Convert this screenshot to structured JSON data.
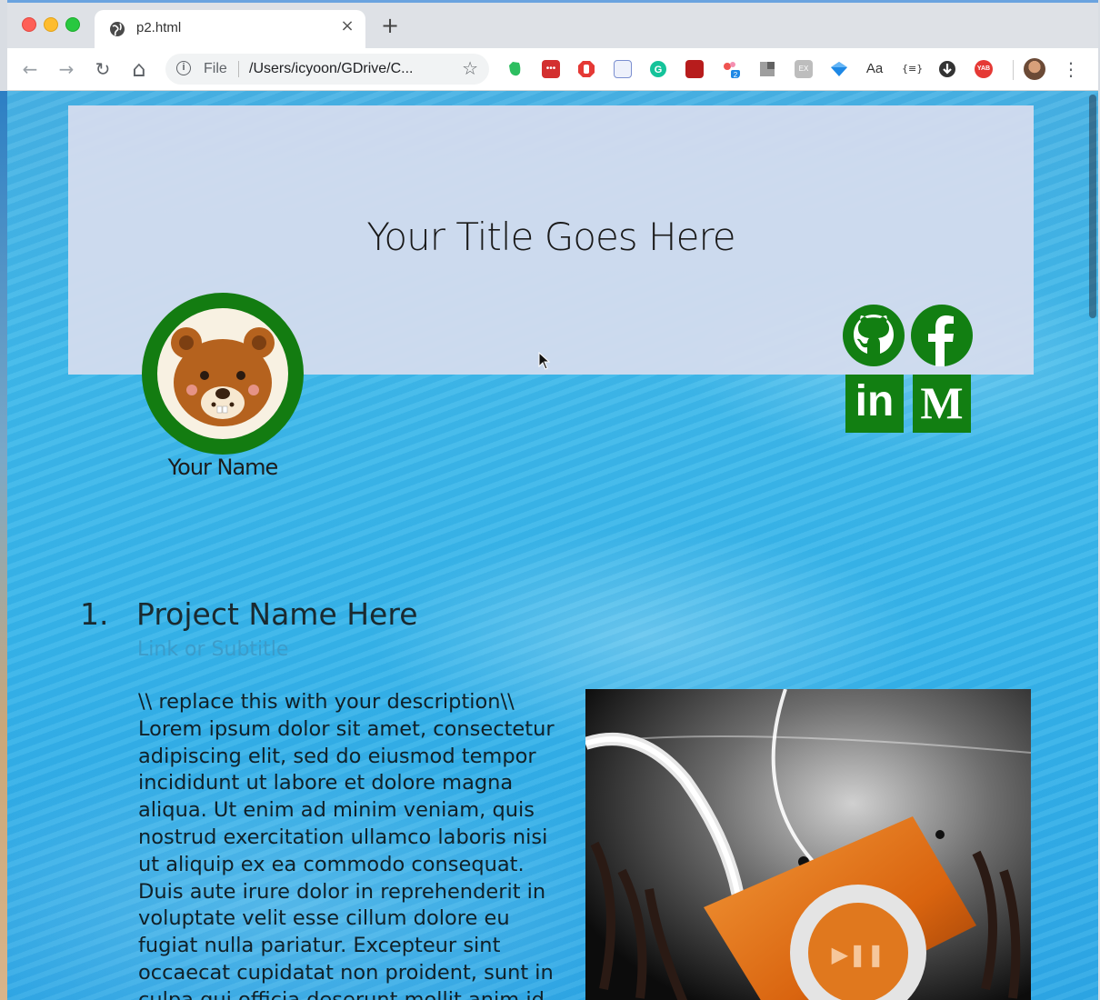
{
  "browser": {
    "tab_title": "p2.html",
    "tab_close": "×",
    "new_tab": "+",
    "nav": {
      "back": "←",
      "forward": "→",
      "reload": "↻",
      "home": "⌂",
      "menu": "⋮"
    },
    "omnibox": {
      "scheme": "File",
      "url": "/Users/icyoon/GDrive/C...",
      "info_icon": "ⓘ",
      "star": "☆"
    },
    "extension_badge": "2",
    "extensions": [
      "evernote-icon",
      "lastpass-icon",
      "adblock-icon",
      "docs-icon",
      "grammarly-icon",
      "tools-icon",
      "share-icon",
      "puzzle-icon",
      "ex-icon",
      "gem-icon",
      "font-icon",
      "json-icon",
      "download-icon",
      "yab-icon"
    ],
    "extension_labels": {
      "font": "Aa",
      "json": "{≡}",
      "yab": "YAB",
      "ex": "EX",
      "lastpass": "•••"
    }
  },
  "header": {
    "title": "Your Title Goes Here",
    "name": "Your Name",
    "social": [
      "github-icon",
      "facebook-icon",
      "linkedin-icon",
      "medium-icon"
    ],
    "linkedin_label": "in",
    "medium_label": "M",
    "accent_color": "#137c11"
  },
  "project": {
    "number": "1.",
    "name": "Project Name Here",
    "subtitle": "Link or Subtitle",
    "description": "\\\\ replace this with your description\\\\ Lorem ipsum dolor sit amet, consectetur adipiscing elit, sed do eiusmod tempor incididunt ut labore et dolore magna aliqua. Ut enim ad minim veniam, quis nostrud exercitation ullamco laboris nisi ut aliquip ex ea commodo consequat. Duis aute irure dolor in reprehenderit in voluptate velit esse cillum dolore eu fugiat nulla pariatur. Excepteur sint occaecat cupidatat non proident, sunt in culpa qui officia deserunt mollit anim id",
    "image": "ipod-shuffle-illustration"
  }
}
